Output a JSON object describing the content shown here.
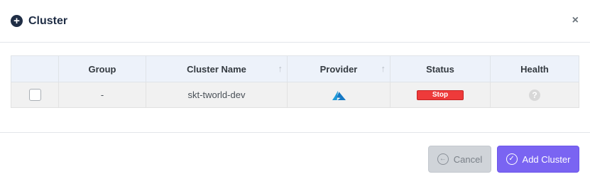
{
  "dialog": {
    "title": "Cluster",
    "close_label": "×"
  },
  "table": {
    "headers": {
      "group": "Group",
      "cluster_name": "Cluster Name",
      "provider": "Provider",
      "status": "Status",
      "health": "Health"
    },
    "sort_glyph": "↑",
    "rows": [
      {
        "selected": false,
        "group": "-",
        "cluster_name": "skt-tworld-dev",
        "provider_icon": "azure-icon",
        "status": "Stop",
        "status_color": "#ee3a3a",
        "health_icon": "question-icon",
        "health_glyph": "?"
      }
    ]
  },
  "footer": {
    "cancel_label": "Cancel",
    "add_label": "Add Cluster"
  },
  "colors": {
    "accent": "#7a64f2",
    "title": "#1f2d45",
    "header_bg": "#edf2fa",
    "azure": "#1f9ad8"
  }
}
